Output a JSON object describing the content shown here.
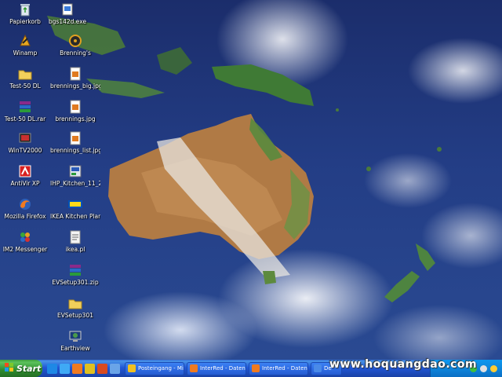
{
  "desktop_icons": [
    {
      "label": "Papierkorb",
      "icon": "recycle-bin-icon"
    },
    {
      "label": "bgs142d.exe",
      "icon": "exe-file-icon"
    },
    {
      "label": "Winamp",
      "icon": "winamp-icon"
    },
    {
      "label": "Brenning's",
      "icon": "brennings-icon"
    },
    {
      "label": "Test-50 DL",
      "icon": "folder-icon"
    },
    {
      "label": "brennings_big.jpg",
      "icon": "jpg-file-icon"
    },
    {
      "label": "Test-50 DL.rar",
      "icon": "rar-file-icon"
    },
    {
      "label": "brennings.jpg",
      "icon": "jpg-file-icon"
    },
    {
      "label": "WinTV2000",
      "icon": "wintv-icon"
    },
    {
      "label": "brennings_list.jpg",
      "icon": "jpg-file-icon"
    },
    {
      "label": "AntiVir XP",
      "icon": "antivir-icon"
    },
    {
      "label": "IHP_Kitchen_11_20...",
      "icon": "installer-icon"
    },
    {
      "label": "Mozilla Firefox",
      "icon": "firefox-icon"
    },
    {
      "label": "IKEA Kitchen Planner",
      "icon": "ikea-icon"
    },
    {
      "label": "IM2 Messenger",
      "icon": "messenger-icon"
    },
    {
      "label": "ikea.pl",
      "icon": "file-icon"
    },
    {
      "label": "EVSetup301.zip",
      "icon": "zip-file-icon"
    },
    {
      "label": "EVSetup301",
      "icon": "folder-icon"
    },
    {
      "label": "Earthview",
      "icon": "earthview-icon"
    }
  ],
  "taskbar": {
    "start_label": "Start",
    "tasks": [
      {
        "label": "Posteingang - Micr...",
        "icon": "outlook-icon"
      },
      {
        "label": "InterRed - Daten b...",
        "icon": "firefox-icon"
      },
      {
        "label": "InterRed - Daten b...",
        "icon": "firefox-icon"
      },
      {
        "label": "De",
        "icon": "window-icon"
      }
    ]
  },
  "watermark": "www.hoquangdao.com"
}
